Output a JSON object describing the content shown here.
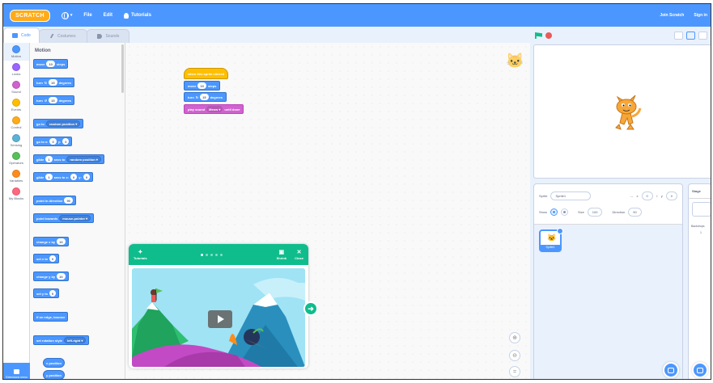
{
  "menubar": {
    "logo": "SCRATCH",
    "file": "File",
    "edit": "Edit",
    "tutorials": "Tutorials",
    "join": "Join Scratch",
    "signin": "Sign in"
  },
  "tabs": {
    "code": "Code",
    "costumes": "Costumes",
    "sounds": "Sounds"
  },
  "categories": [
    {
      "label": "Motion",
      "color": "#4c97ff"
    },
    {
      "label": "Looks",
      "color": "#9966ff"
    },
    {
      "label": "Sound",
      "color": "#cf63cf"
    },
    {
      "label": "Events",
      "color": "#ffbf00"
    },
    {
      "label": "Control",
      "color": "#ffab19"
    },
    {
      "label": "Sensing",
      "color": "#5cb1d6"
    },
    {
      "label": "Operators",
      "color": "#59c059"
    },
    {
      "label": "Variables",
      "color": "#ff8c1a"
    },
    {
      "label": "My Blocks",
      "color": "#ff6680"
    }
  ],
  "flyout": {
    "title": "Motion",
    "move": {
      "a": "move",
      "n": "10",
      "b": "steps"
    },
    "turn_right": {
      "a": "turn",
      "n": "15",
      "b": "degrees"
    },
    "turn_left": {
      "a": "turn",
      "n": "15",
      "b": "degrees"
    },
    "go_to": {
      "a": "go to",
      "d": "random position ▾"
    },
    "go_to_xy": {
      "a": "go to x:",
      "x": "0",
      "m": "y:",
      "y": "0"
    },
    "glide": {
      "a": "glide",
      "n": "1",
      "m": "secs to",
      "d": "random position ▾"
    },
    "glide_xy": {
      "a": "glide",
      "n": "1",
      "m": "secs to x:",
      "x": "0",
      "k": "y:",
      "y": "0"
    },
    "point_dir": {
      "a": "point in direction",
      "n": "90"
    },
    "point_towards": {
      "a": "point towards",
      "d": "mouse-pointer ▾"
    },
    "change_x": {
      "a": "change x by",
      "n": "10"
    },
    "set_x": {
      "a": "set x to",
      "n": "0"
    },
    "change_y": {
      "a": "change y by",
      "n": "10"
    },
    "set_y": {
      "a": "set y to",
      "n": "0"
    },
    "bounce": "if on edge, bounce",
    "rotation": {
      "a": "set rotation style",
      "d": "left-right ▾"
    },
    "x_pos": "x position",
    "y_pos": "y position"
  },
  "script": {
    "hat": "when this sprite clicked",
    "move": {
      "a": "move",
      "n": "10",
      "b": "steps"
    },
    "turn": {
      "a": "turn",
      "n": "15",
      "b": "degrees"
    },
    "sound": {
      "a": "play sound",
      "d": "Meow ▾",
      "b": "until done"
    }
  },
  "tutorial": {
    "label": "Tutorials",
    "shrink": "Shrink",
    "close": "Close"
  },
  "sprite_info": {
    "sprite_label": "Sprite",
    "sprite_name": "Sprite1",
    "x_label": "x",
    "x": "0",
    "y_label": "y",
    "y": "0",
    "show_label": "Show",
    "size_label": "Size",
    "size": "100",
    "direction_label": "Direction",
    "direction": "90"
  },
  "sprite_list": {
    "thumb_name": "Sprite1"
  },
  "stage_pane": {
    "title": "Stage",
    "backdrops_label": "Backdrops",
    "backdrops_count": "1"
  },
  "extension": {
    "label": "Extensions menu"
  }
}
